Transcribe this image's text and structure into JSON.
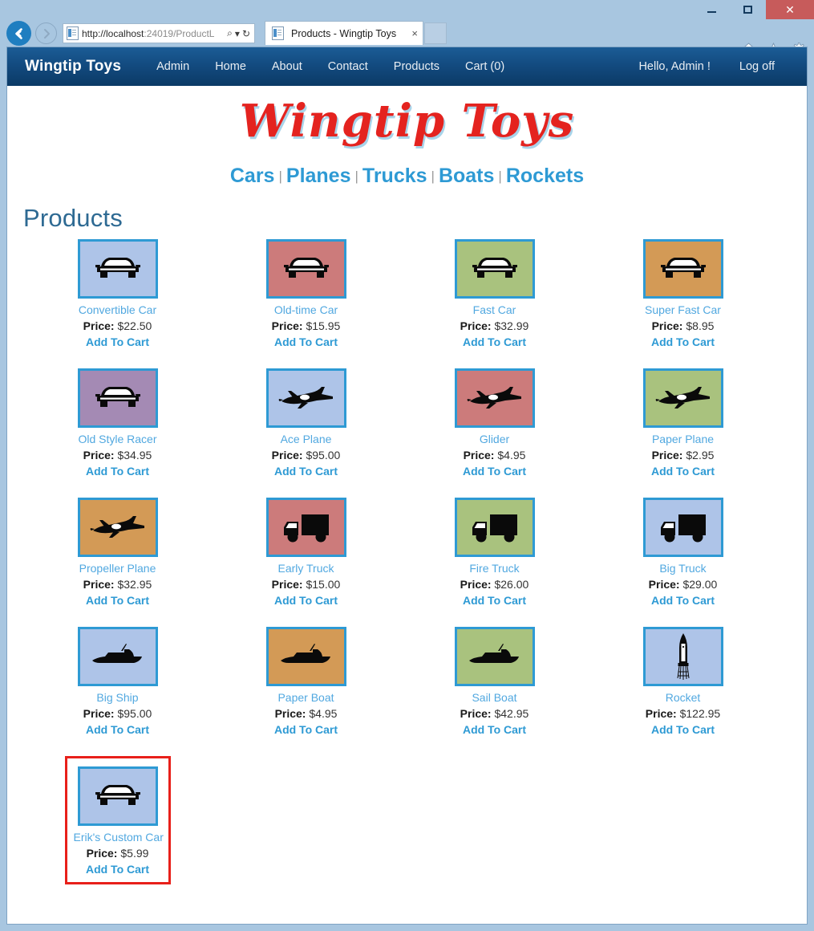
{
  "browser": {
    "url_bold": "http://localhost",
    "url_dim": ":24019/ProductL",
    "tab_title": "Products - Wingtip Toys",
    "tab_close": "×",
    "search_glyph": "⌕",
    "dropdown_glyph": "▾",
    "refresh_glyph": "↻",
    "minimize_label": "Minimize",
    "maximize_label": "Maximize",
    "close_label": "✕"
  },
  "sitenav": {
    "brand": "Wingtip Toys",
    "links": [
      {
        "label": "Admin"
      },
      {
        "label": "Home"
      },
      {
        "label": "About"
      },
      {
        "label": "Contact"
      },
      {
        "label": "Products"
      },
      {
        "label": "Cart (0)"
      }
    ],
    "greeting": "Hello, Admin !",
    "logoff": "Log off"
  },
  "logo": {
    "text": "Wingtip Toys",
    "color": "#e4231f",
    "shadow": "#a8d4ea"
  },
  "categories": {
    "separator": "|",
    "items": [
      {
        "label": "Cars"
      },
      {
        "label": "Planes"
      },
      {
        "label": "Trucks"
      },
      {
        "label": "Boats"
      },
      {
        "label": "Rockets"
      }
    ]
  },
  "page": {
    "title": "Products",
    "price_label": "Price:",
    "add_to_cart": "Add To Cart"
  },
  "colors": {
    "accent_blue": "#2e9ad4",
    "link_blue": "#51a8e0",
    "navbar_dark": "#0b3a66",
    "highlight_red": "#e8201a",
    "heading": "#2e6a93"
  },
  "products": [
    {
      "name": "Convertible Car",
      "price": "$22.50",
      "icon": "car-icon",
      "bg": "#aec4e8",
      "highlight": false
    },
    {
      "name": "Old-time Car",
      "price": "$15.95",
      "icon": "car-icon",
      "bg": "#cc7b7b",
      "highlight": false
    },
    {
      "name": "Fast Car",
      "price": "$32.99",
      "icon": "car-icon",
      "bg": "#a9c27e",
      "highlight": false
    },
    {
      "name": "Super Fast Car",
      "price": "$8.95",
      "icon": "car-icon",
      "bg": "#d39a56",
      "highlight": false
    },
    {
      "name": "Old Style Racer",
      "price": "$34.95",
      "icon": "car-icon",
      "bg": "#a48ab4",
      "highlight": false
    },
    {
      "name": "Ace Plane",
      "price": "$95.00",
      "icon": "plane-icon",
      "bg": "#aec4e8",
      "highlight": false
    },
    {
      "name": "Glider",
      "price": "$4.95",
      "icon": "plane-icon",
      "bg": "#cc7b7b",
      "highlight": false
    },
    {
      "name": "Paper Plane",
      "price": "$2.95",
      "icon": "plane-icon",
      "bg": "#a9c27e",
      "highlight": false
    },
    {
      "name": "Propeller Plane",
      "price": "$32.95",
      "icon": "plane-icon",
      "bg": "#d39a56",
      "highlight": false
    },
    {
      "name": "Early Truck",
      "price": "$15.00",
      "icon": "truck-icon",
      "bg": "#cc7b7b",
      "highlight": false
    },
    {
      "name": "Fire Truck",
      "price": "$26.00",
      "icon": "truck-icon",
      "bg": "#a9c27e",
      "highlight": false
    },
    {
      "name": "Big Truck",
      "price": "$29.00",
      "icon": "truck-icon",
      "bg": "#aec4e8",
      "highlight": false
    },
    {
      "name": "Big Ship",
      "price": "$95.00",
      "icon": "boat-icon",
      "bg": "#aec4e8",
      "highlight": false
    },
    {
      "name": "Paper Boat",
      "price": "$4.95",
      "icon": "boat-icon",
      "bg": "#d39a56",
      "highlight": false
    },
    {
      "name": "Sail Boat",
      "price": "$42.95",
      "icon": "boat-icon",
      "bg": "#a9c27e",
      "highlight": false
    },
    {
      "name": "Rocket",
      "price": "$122.95",
      "icon": "rocket-icon",
      "bg": "#aec4e8",
      "highlight": false
    },
    {
      "name": "Erik's Custom Car",
      "price": "$5.99",
      "icon": "car-icon",
      "bg": "#aec4e8",
      "highlight": true
    }
  ]
}
